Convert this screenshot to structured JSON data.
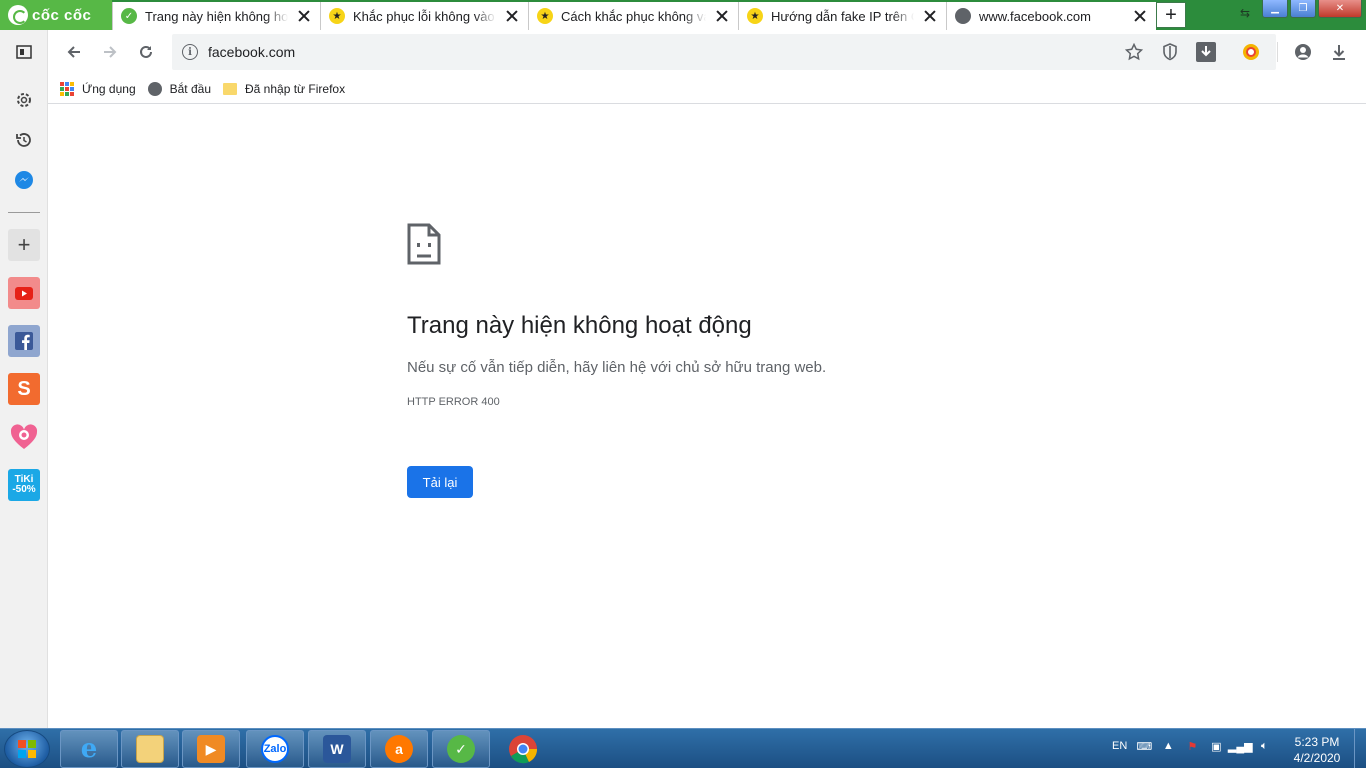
{
  "browser": {
    "brand_name": "cốc cốc",
    "tabs": [
      {
        "title": "Trang này hiện không hoạt động",
        "favicon": "coccoc-icon"
      },
      {
        "title": "Khắc phục lỗi không vào được Facebook",
        "favicon": "runner-icon"
      },
      {
        "title": "Cách khắc phục không vào được",
        "favicon": "runner-icon"
      },
      {
        "title": "Hướng dẫn fake IP trên Cốc Cốc",
        "favicon": "runner-icon"
      },
      {
        "title": "www.facebook.com",
        "favicon": "globe-icon",
        "active": true
      }
    ],
    "new_tab_label": "+"
  },
  "toolbar": {
    "url": "facebook.com"
  },
  "bookmarks": [
    {
      "label": "Ứng dụng",
      "icon": "apps-grid-icon"
    },
    {
      "label": "Bắt đầu",
      "icon": "globe-icon"
    },
    {
      "label": "Đã nhập từ Firefox",
      "icon": "folder-icon"
    }
  ],
  "sidebar": {
    "items": [
      "settings-icon",
      "history-icon",
      "messenger-icon",
      "add-icon",
      "youtube-icon",
      "facebook-icon",
      "shopee-icon",
      "heart-app-icon",
      "tiki-icon"
    ],
    "shopee_letter": "S",
    "tiki_top": "TiKi",
    "tiki_bottom": "-50%"
  },
  "error_page": {
    "title": "Trang này hiện không hoạt động",
    "message": "Nếu sự cố vẫn tiếp diễn, hãy liên hệ với chủ sở hữu trang web.",
    "error_code": "HTTP ERROR 400",
    "reload_label": "Tải lại"
  },
  "taskbar": {
    "apps": [
      "internet-explorer-icon",
      "file-explorer-icon",
      "media-player-icon",
      "zalo-icon",
      "word-icon",
      "avast-icon",
      "coccoc-icon",
      "chrome-icon"
    ],
    "zalo_label": "Zalo",
    "word_letter": "W",
    "avast_letter": "a",
    "language": "EN",
    "time": "5:23 PM",
    "date": "4/2/2020"
  },
  "colors": {
    "tabstrip": "#2c8c3c",
    "brand": "#57b846",
    "reload_button": "#1a73e8",
    "taskbar": "#1c4f83"
  }
}
